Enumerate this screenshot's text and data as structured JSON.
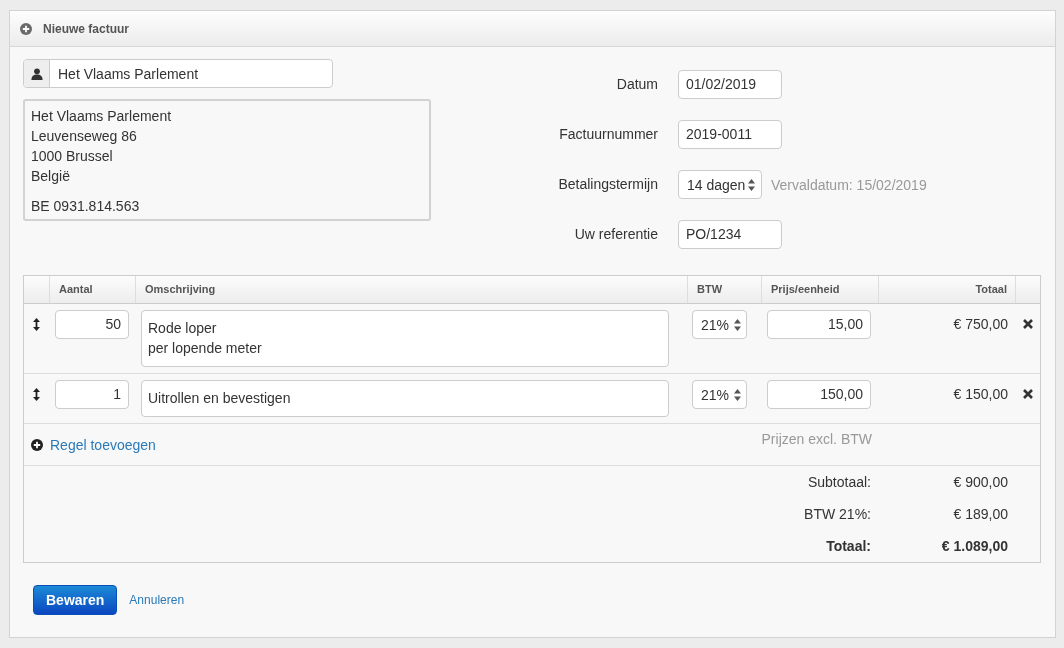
{
  "panel": {
    "title": "Nieuwe factuur"
  },
  "customer": {
    "name": "Het Vlaams Parlement",
    "address_lines": [
      "Het Vlaams Parlement",
      "Leuvenseweg 86",
      "1000 Brussel",
      "België"
    ],
    "vat_number": "BE 0931.814.563"
  },
  "fields": [
    {
      "label": "Datum",
      "value": "01/02/2019",
      "kind": "input"
    },
    {
      "label": "Factuurnummer",
      "value": "2019-0011",
      "kind": "input"
    },
    {
      "label": "Betalingstermijn",
      "value": "14 dagen",
      "kind": "select",
      "note": "Vervaldatum: 15/02/2019"
    },
    {
      "label": "Uw referentie",
      "value": "PO/1234",
      "kind": "input"
    }
  ],
  "table": {
    "columns": [
      "Aantal",
      "Omschrijving",
      "BTW",
      "Prijs/eenheid",
      "Totaal"
    ],
    "rows": [
      {
        "quantity": "50",
        "description_lines": [
          "Rode loper",
          "per lopende meter"
        ],
        "vat": "21%",
        "unit_price": "15,00",
        "total": "€ 750,00"
      },
      {
        "quantity": "1",
        "description_lines": [
          "Uitrollen en bevestigen"
        ],
        "vat": "21%",
        "unit_price": "150,00",
        "total": "€ 150,00"
      }
    ],
    "add_line": "Regel toevoegen",
    "prices_note": "Prijzen excl. BTW",
    "totals": [
      {
        "label": "Subtotaal:",
        "value": "€ 900,00",
        "kind": "subtotal"
      },
      {
        "label": "BTW 21%:",
        "value": "€ 189,00",
        "kind": "tax"
      },
      {
        "label": "Totaal:",
        "value": "€ 1.089,00",
        "kind": "total"
      }
    ]
  },
  "actions": [
    {
      "label": "Bewaren",
      "kind": "primary"
    },
    {
      "label": "Annuleren",
      "kind": "link"
    }
  ]
}
